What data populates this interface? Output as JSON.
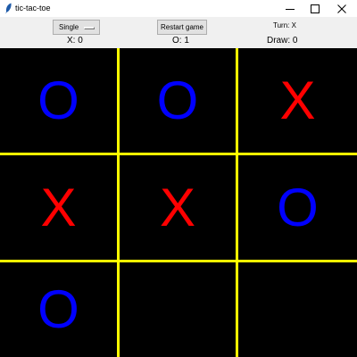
{
  "window": {
    "title": "tic-tac-toe",
    "icon": "feather-icon",
    "controls": [
      "minimize-icon",
      "maximize-icon",
      "close-icon"
    ]
  },
  "toolbar": {
    "mode_label": "Single",
    "restart_label": "Restart game",
    "turn_label": "Turn: X"
  },
  "scores": {
    "x": "X: 0",
    "o": "O: 1",
    "draw": "Draw: 0"
  },
  "board": {
    "cells": [
      [
        "O",
        "O",
        "X"
      ],
      [
        "X",
        "X",
        "O"
      ],
      [
        "O",
        "",
        ""
      ]
    ]
  },
  "colors": {
    "board_background": "#000000",
    "grid_lines": "#ffff00",
    "x_mark": "#ff0000",
    "o_mark": "#0000ff"
  }
}
